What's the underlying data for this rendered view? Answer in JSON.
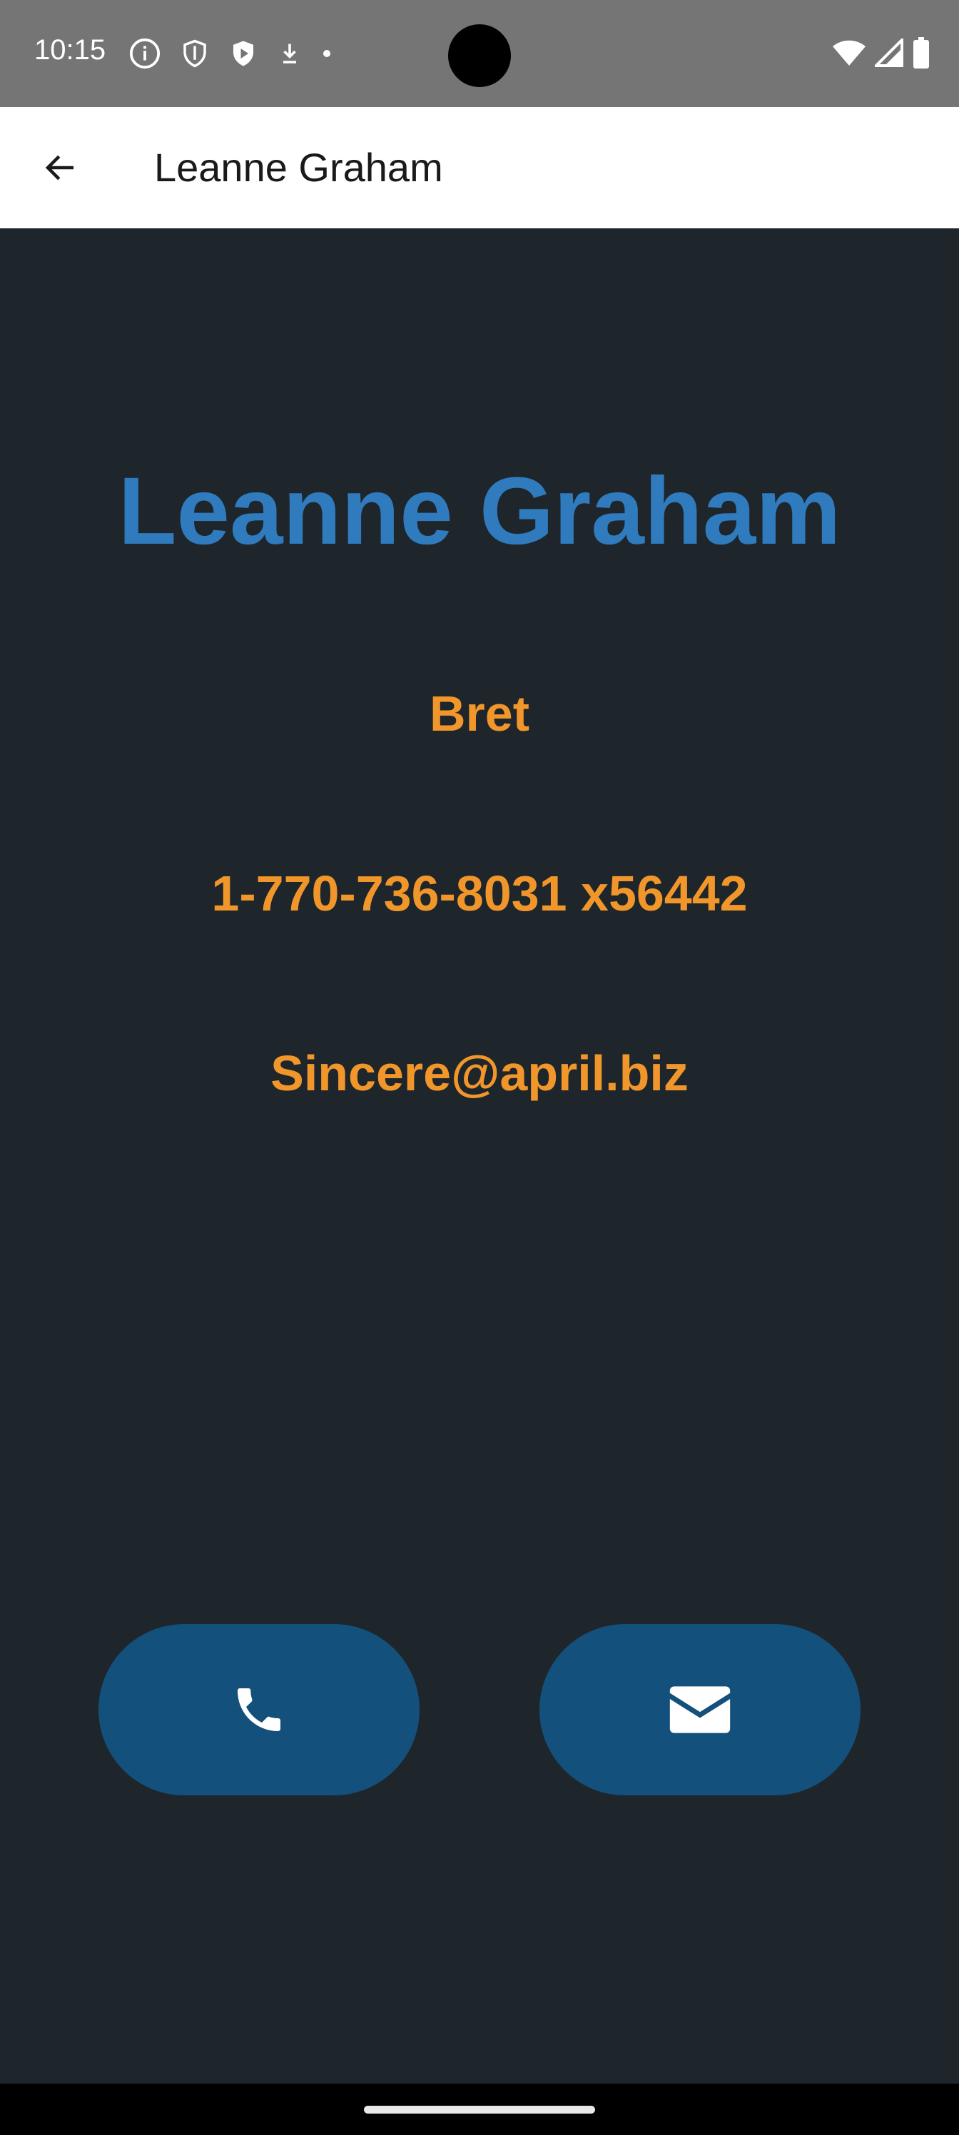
{
  "status_bar": {
    "time": "10:15",
    "left_icons": [
      "info-icon",
      "shield-icon",
      "play-protect-icon",
      "download-icon",
      "dot-icon"
    ],
    "right_icons": [
      "wifi-icon",
      "signal-icon",
      "battery-icon"
    ]
  },
  "app_bar": {
    "title": "Leanne Graham",
    "back_icon": "arrow-back-icon"
  },
  "contact": {
    "name": "Leanne Graham",
    "username": "Bret",
    "phone": "1-770-736-8031 x56442",
    "email": "Sincere@april.biz"
  },
  "actions": {
    "call_icon": "phone-icon",
    "email_icon": "mail-icon"
  },
  "colors": {
    "background": "#1e252b",
    "name": "#2f7bbd",
    "details": "#f0962a",
    "button": "#14507c",
    "status_bar": "#757575"
  }
}
